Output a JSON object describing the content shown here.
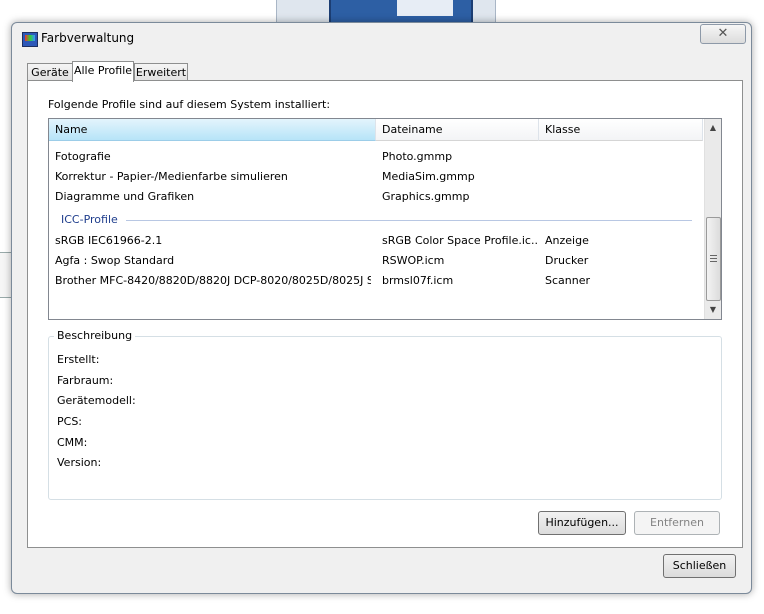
{
  "window": {
    "title": "Farbverwaltung",
    "close_symbol": "✕"
  },
  "tabs": [
    {
      "label": "Geräte",
      "active": false
    },
    {
      "label": "Alle Profile",
      "active": true
    },
    {
      "label": "Erweitert",
      "active": false
    }
  ],
  "intro_text": "Folgende Profile sind auf diesem System installiert:",
  "list": {
    "columns": [
      "Name",
      "Dateiname",
      "Klasse"
    ],
    "rows_wcs": [
      {
        "name": "Fotografie",
        "file": "Photo.gmmp",
        "klass": ""
      },
      {
        "name": "Korrektur - Papier-/Medienfarbe simulieren",
        "file": "MediaSim.gmmp",
        "klass": ""
      },
      {
        "name": "Diagramme und Grafiken",
        "file": "Graphics.gmmp",
        "klass": ""
      }
    ],
    "group_label": "ICC-Profile",
    "rows_icc": [
      {
        "name": "sRGB IEC61966-2.1",
        "file": "sRGB Color Space Profile.ic...",
        "klass": "Anzeige"
      },
      {
        "name": "Agfa : Swop Standard",
        "file": "RSWOP.icm",
        "klass": "Drucker"
      },
      {
        "name": "Brother MFC-8420/8820D/8820J DCP-8020/8025D/8025J Sc...",
        "file": "brmsl07f.icm",
        "klass": "Scanner"
      }
    ]
  },
  "description": {
    "title": "Beschreibung",
    "fields": [
      "Erstellt:",
      "Farbraum:",
      "Gerätemodell:",
      "PCS:",
      "CMM:",
      "Version:"
    ]
  },
  "buttons": {
    "add": "Hinzufügen...",
    "remove": "Entfernen",
    "close": "Schließen"
  },
  "icons": {
    "title_icon": "color-management-icon",
    "scroll_up": "▲",
    "scroll_down": "▼"
  }
}
